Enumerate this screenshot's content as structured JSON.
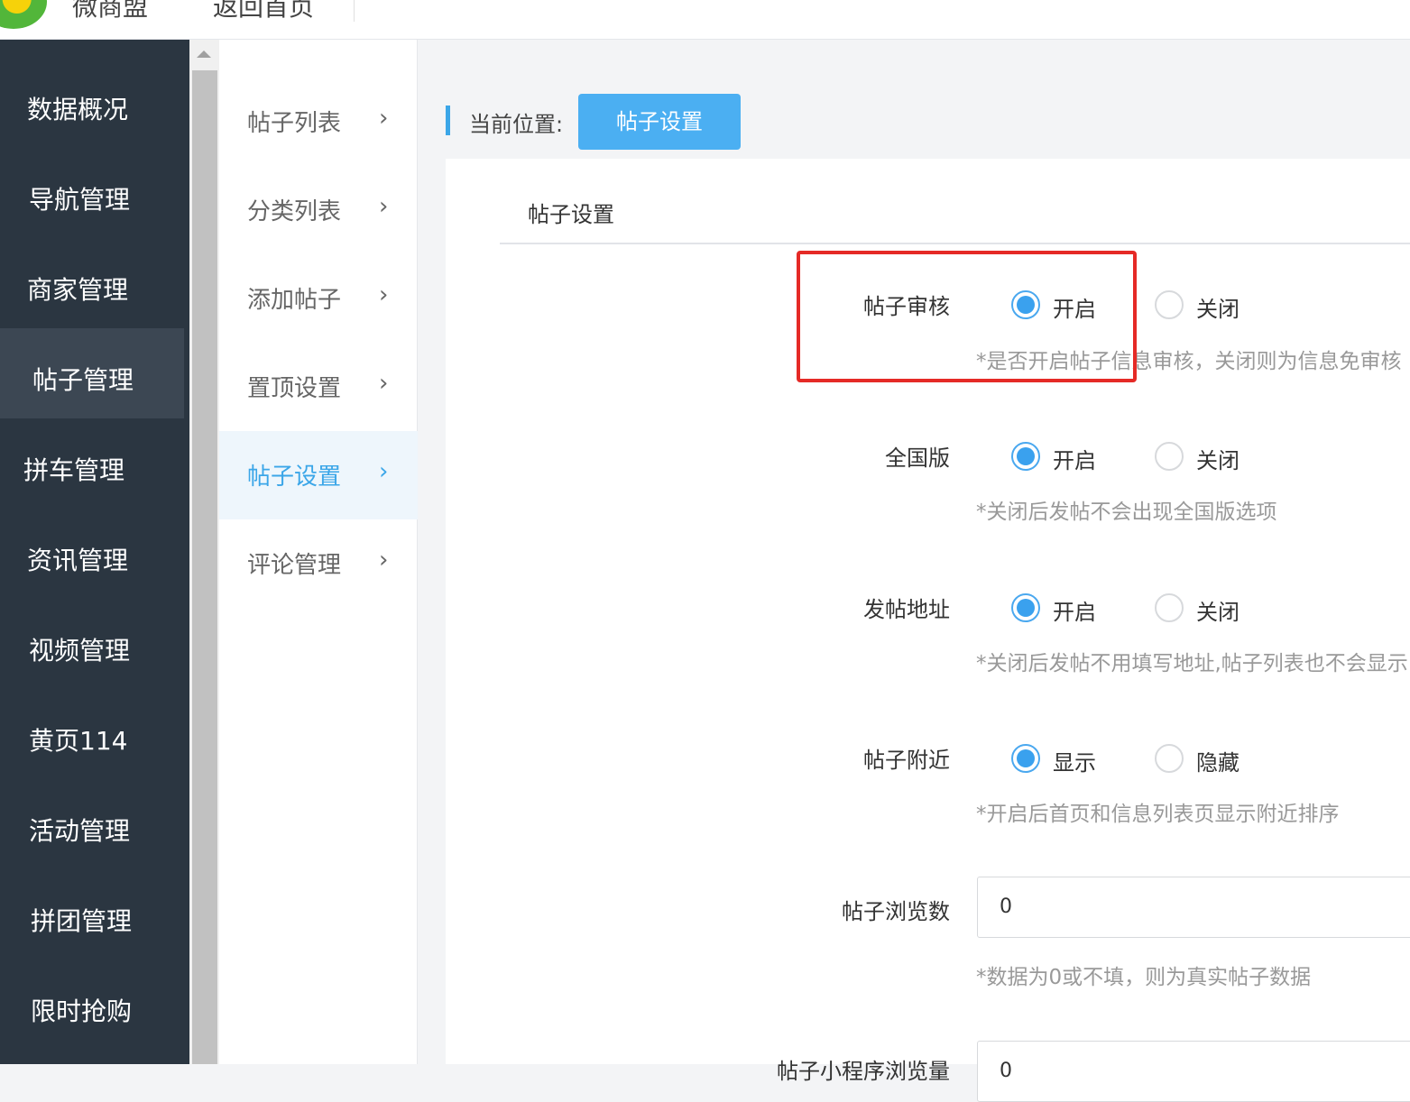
{
  "topbar": {
    "links": [
      "微商盟",
      "返回首页"
    ]
  },
  "sidebar": {
    "items": [
      {
        "label": "数据概况",
        "active": false
      },
      {
        "label": "导航管理",
        "active": false
      },
      {
        "label": "商家管理",
        "active": false
      },
      {
        "label": "帖子管理",
        "active": true
      },
      {
        "label": "拼车管理",
        "active": false
      },
      {
        "label": "资讯管理",
        "active": false
      },
      {
        "label": "视频管理",
        "active": false
      },
      {
        "label": "黄页114",
        "active": false
      },
      {
        "label": "活动管理",
        "active": false
      },
      {
        "label": "拼团管理",
        "active": false
      },
      {
        "label": "限时抢购",
        "active": false
      }
    ]
  },
  "subnav": {
    "items": [
      {
        "label": "帖子列表",
        "active": false
      },
      {
        "label": "分类列表",
        "active": false
      },
      {
        "label": "添加帖子",
        "active": false
      },
      {
        "label": "置顶设置",
        "active": false
      },
      {
        "label": "帖子设置",
        "active": true
      },
      {
        "label": "评论管理",
        "active": false
      }
    ],
    "chevron": "›"
  },
  "breadcrumb": {
    "label": "当前位置:",
    "current": "帖子设置"
  },
  "panel": {
    "title": "帖子设置"
  },
  "settings": [
    {
      "label": "帖子审核",
      "options": [
        "开启",
        "关闭"
      ],
      "selected": 0,
      "hint": "*是否开启帖子信息审核，关闭则为信息免审核"
    },
    {
      "label": "全国版",
      "options": [
        "开启",
        "关闭"
      ],
      "selected": 0,
      "hint": "*关闭后发帖不会出现全国版选项"
    },
    {
      "label": "发帖地址",
      "options": [
        "开启",
        "关闭"
      ],
      "selected": 0,
      "hint": "*关闭后发帖不用填写地址,帖子列表也不会显示"
    },
    {
      "label": "帖子附近",
      "options": [
        "显示",
        "隐藏"
      ],
      "selected": 0,
      "hint": "*开启后首页和信息列表页显示附近排序"
    }
  ],
  "views_field": {
    "label": "帖子浏览数",
    "value": "0",
    "hint": "*数据为0或不填，则为真实帖子数据"
  },
  "next_field": {
    "label": "帖子小程序浏览量",
    "value": "0"
  },
  "colors": {
    "sidebar_bg": "#2b3641",
    "accent": "#3ba6e8",
    "highlight": "#e52a26"
  }
}
